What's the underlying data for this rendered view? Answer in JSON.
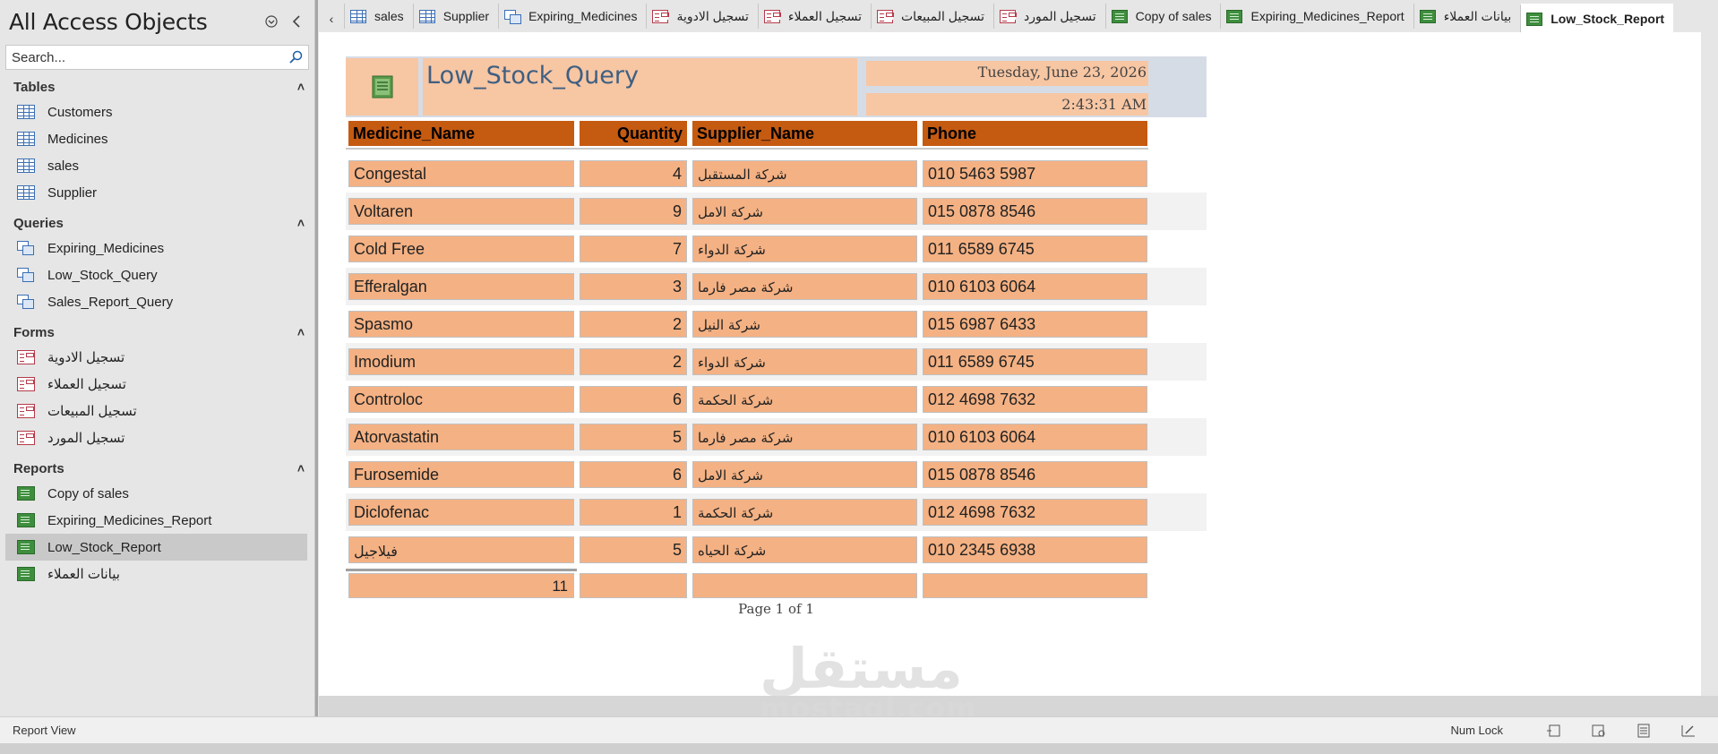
{
  "nav": {
    "title": "All Access Objects",
    "search_placeholder": "Search...",
    "groups": [
      {
        "label": "Tables",
        "items": [
          {
            "label": "Customers"
          },
          {
            "label": "Medicines"
          },
          {
            "label": "sales"
          },
          {
            "label": "Supplier"
          }
        ]
      },
      {
        "label": "Queries",
        "items": [
          {
            "label": "Expiring_Medicines"
          },
          {
            "label": "Low_Stock_Query"
          },
          {
            "label": "Sales_Report_Query"
          }
        ]
      },
      {
        "label": "Forms",
        "items": [
          {
            "label": "تسجيل الادوية"
          },
          {
            "label": "تسجيل العملاء"
          },
          {
            "label": "تسجيل المبيعات"
          },
          {
            "label": "تسجيل المورد"
          }
        ]
      },
      {
        "label": "Reports",
        "items": [
          {
            "label": "Copy of sales"
          },
          {
            "label": "Expiring_Medicines_Report"
          },
          {
            "label": "Low_Stock_Report",
            "selected": true
          },
          {
            "label": "بيانات العملاء"
          }
        ]
      }
    ]
  },
  "tabs": [
    {
      "label": "sales",
      "icon": "table-icon"
    },
    {
      "label": "Supplier",
      "icon": "table-icon"
    },
    {
      "label": "Expiring_Medicines",
      "icon": "query-icon"
    },
    {
      "label": "تسجيل الادوية",
      "icon": "form-icon"
    },
    {
      "label": "تسجيل العملاء",
      "icon": "form-icon"
    },
    {
      "label": "تسجيل المبيعات",
      "icon": "form-icon"
    },
    {
      "label": "تسجيل المورد",
      "icon": "form-icon"
    },
    {
      "label": "Copy of sales",
      "icon": "report-icon"
    },
    {
      "label": "Expiring_Medicines_Report",
      "icon": "report-icon"
    },
    {
      "label": "بيانات العملاء",
      "icon": "report-icon"
    },
    {
      "label": "Low_Stock_Report",
      "icon": "report-icon",
      "active": true
    }
  ],
  "report": {
    "title": "Low_Stock_Query",
    "date": "Tuesday, June 23, 2026",
    "time": "2:43:31 AM",
    "columns": [
      "Medicine_Name",
      "Quantity",
      "Supplier_Name",
      "Phone"
    ],
    "rows": [
      [
        "Congestal",
        "4",
        "شركة المستقبل",
        "010 5463 5987"
      ],
      [
        "Voltaren",
        "9",
        "شركة الامل",
        "015 0878 8546"
      ],
      [
        "Cold Free",
        "7",
        "شركة الدواء",
        "011 6589 6745"
      ],
      [
        "Efferalgan",
        "3",
        "شركة مصر فارما",
        "010 6103 6064"
      ],
      [
        "Spasmo",
        "2",
        "شركة النيل",
        "015 6987 6433"
      ],
      [
        "Imodium",
        "2",
        "شركة الدواء",
        "011 6589 6745"
      ],
      [
        "Controloc",
        "6",
        "شركة الحكمة",
        "012 4698 7632"
      ],
      [
        "Atorvastatin",
        "5",
        "شركة مصر فارما",
        "010 6103 6064"
      ],
      [
        "Furosemide",
        "6",
        "شركة الامل",
        "015 0878 8546"
      ],
      [
        "Diclofenac",
        "1",
        "شركة الحكمة",
        "012 4698 7632"
      ],
      [
        "فيلاجيل",
        "5",
        "شركة الحياه",
        "010 2345 6938"
      ]
    ],
    "total": "11",
    "page_label": "Page 1 of 1"
  },
  "watermark": {
    "arabic": "مستقل",
    "latin": "mostaql.com"
  },
  "status": {
    "view": "Report View",
    "numlock": "Num Lock"
  },
  "colors": {
    "header_fill": "#c55a11",
    "cell_fill": "#f4b183",
    "title_fill": "#f7c6a3",
    "title_text": "#3f5f82"
  }
}
